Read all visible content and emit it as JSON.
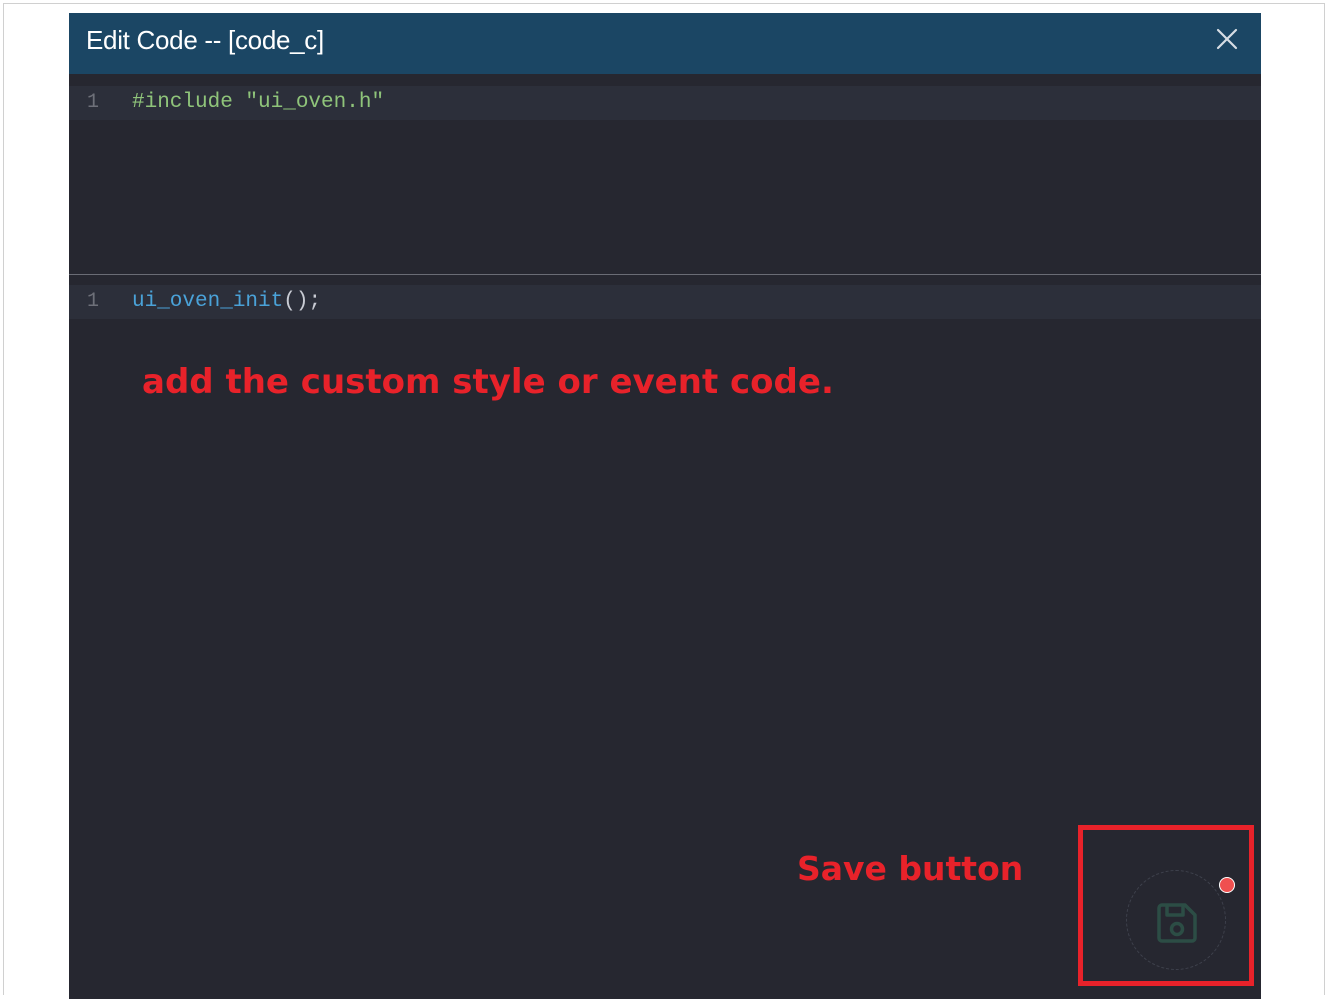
{
  "dialog": {
    "title": "Edit Code -- [code_c]",
    "close_icon": "close-icon"
  },
  "editor_top": {
    "lines": [
      {
        "number": "1",
        "code": "#include \"ui_oven.h\""
      }
    ]
  },
  "editor_bottom": {
    "lines": [
      {
        "number": "1",
        "code_fn": "ui_oven_init",
        "code_punct": "();"
      }
    ]
  },
  "annotations": {
    "custom_code": "add the custom style or event code.",
    "save_button": "Save button"
  },
  "save_button": {
    "icon": "save-icon",
    "unsaved_indicator": true
  },
  "colors": {
    "titlebar": "#1b4664",
    "editor_bg": "#262730",
    "annotation": "#e8222a",
    "string_green": "#8fc47a",
    "function_blue": "#4aa2d8",
    "unsaved_dot": "#ef5050"
  }
}
